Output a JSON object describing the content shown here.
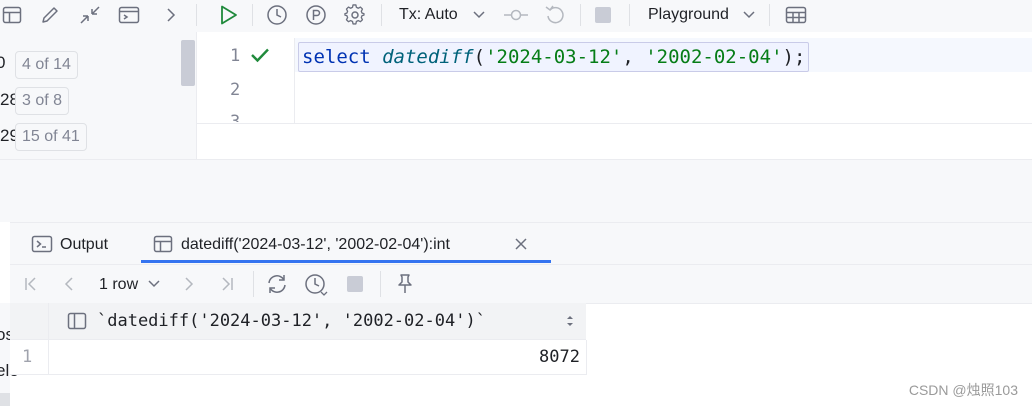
{
  "toolbar": {
    "tx_label": "Tx: Auto",
    "playground_label": "Playground"
  },
  "left_panel": {
    "rows": [
      {
        "num": "0",
        "badge": "4 of 14"
      },
      {
        "num": "28",
        "badge": "3 of 8"
      },
      {
        "num": "29",
        "badge": "15 of 41"
      }
    ]
  },
  "editor": {
    "line_numbers": [
      "1",
      "2",
      "3"
    ],
    "code": {
      "keyword": "select",
      "func": "datediff",
      "open": "(",
      "arg1": "'2024-03-12'",
      "comma": ", ",
      "arg2": "'2002-02-04'",
      "close": ");"
    }
  },
  "services": {
    "tabs": [
      {
        "label": "Output"
      },
      {
        "label": "datediff('2024-03-12', '2002-02-04'):int"
      }
    ],
    "row_count_label": "1 row"
  },
  "result_grid": {
    "columns": [
      "`datediff('2024-03-12', '2002-02-04')`"
    ],
    "rows": [
      {
        "index": "1",
        "cells": [
          "8072"
        ]
      }
    ]
  },
  "left_edge_fragments": [
    "os",
    "ele"
  ],
  "watermark": "CSDN @烛照103",
  "colors": {
    "accent": "#3574f0",
    "run_green": "#208a3c",
    "keyword": "#0033b3",
    "function": "#00627a",
    "string": "#067d17"
  }
}
